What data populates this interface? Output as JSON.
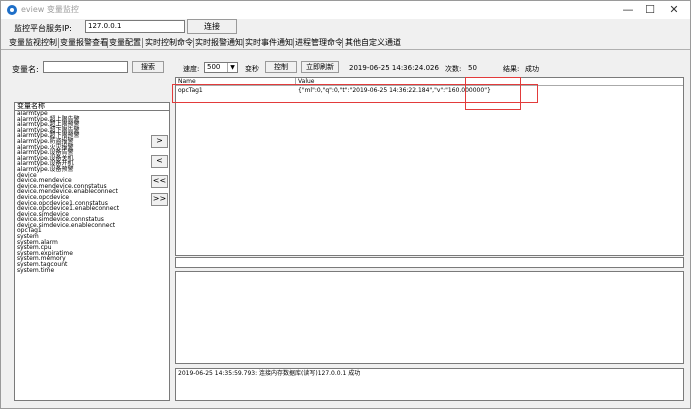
{
  "window": {
    "title": "eview 变量监控",
    "controls": {
      "minimize": "—",
      "maximize": "☐",
      "close": "✕"
    }
  },
  "server": {
    "label": "监控平台服务IP:",
    "ip": "127.0.0.1",
    "connect_label": "连接"
  },
  "tabs": [
    "变量监视控制",
    "变量报警查看",
    "变量配置",
    "实时控制命令",
    "实时报警通知",
    "实时事件通知",
    "进程管理命令",
    "其他自定义通道"
  ],
  "toolbar": {
    "var_label": "变量名:",
    "search_label": "搜索",
    "speed_label": "速度:",
    "speed_value": "500",
    "change_label": "变秒",
    "control_label": "控制",
    "refresh_label": "立即刷新",
    "timestamp": "2019-06-25 14:36:24.026",
    "count_label": "次数:",
    "count_value": "50",
    "result_label": "结果:",
    "result_value": "成功"
  },
  "var_list": {
    "header": "变量名称",
    "items": [
      "alarmtype",
      "alarmtype.超上限告警",
      "alarmtype.超上限预警",
      "alarmtype.超下限告警",
      "alarmtype.超下限预警",
      "alarmtype.防盗报警",
      "alarmtype.火灾报警",
      "alarmtype.设备告警",
      "alarmtype.设备关机",
      "alarmtype.设备开机",
      "alarmtype.设备预警",
      "device",
      "device.mendevice",
      "device.mendevice.connstatus",
      "device.mendevice.enableconnect",
      "device.opcdevice",
      "device.opcdevice1.connstatus",
      "device.opcdevice1.enableconnect",
      "device.simdevice",
      "device.simdevice.connstatus",
      "device.simdevice.enableconnect",
      "opcTag1",
      "system",
      "system.alarm",
      "system.cpu",
      "system.expiratime",
      "system.memory",
      "system.tagcount",
      "system.time"
    ]
  },
  "side_buttons": [
    ">",
    "<",
    "<<",
    ">>"
  ],
  "grid": {
    "col_name": "Name",
    "col_value": "Value",
    "rows": [
      {
        "name": "opcTag1",
        "value_prefix": "{\"ml\":0,\"q\":0,\"t\":\"2019-06-25 14:36:22.184\",\"v\":",
        "value_highlight": "\"160.000000\"",
        "value_suffix": "}"
      }
    ]
  },
  "log": {
    "line": "2019-06-25 14:35:59.793: 连接内存数据库(读写)127.0.0.1 成功"
  }
}
